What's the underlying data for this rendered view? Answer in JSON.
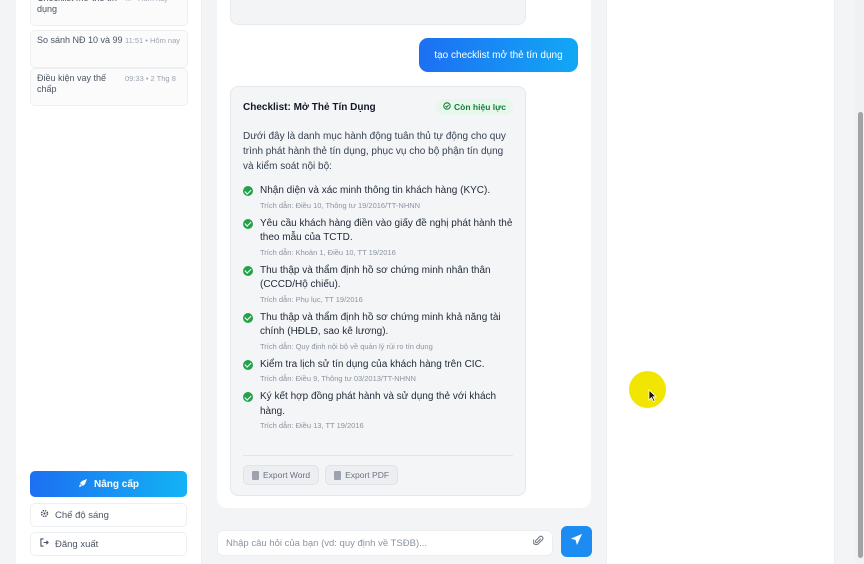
{
  "sidebar": {
    "history": [
      {
        "title": "Checklist mở thẻ tín dụng",
        "time": "... • Hôm nay"
      },
      {
        "title": "So sánh NĐ 10 và 99",
        "time": "11:51 • Hôm nay"
      },
      {
        "title": "Điều kiện vay thế chấp",
        "time": "09:33 • 2 Thg 8"
      }
    ],
    "upgrade_label": "Nâng cấp",
    "light_mode_label": "Chế độ sáng",
    "logout_label": "Đăng xuất"
  },
  "chat": {
    "user_message": "tạo checklist mở thẻ tín dụng",
    "card": {
      "title": "Checklist: Mở Thẻ Tín Dụng",
      "badge": "Còn hiệu lực",
      "intro": "Dưới đây là danh mục hành động tuân thủ tự động cho quy trình phát hành thẻ tín dụng, phục vụ cho bộ phận tín dụng và kiểm soát nội bộ:",
      "items": [
        {
          "text": "Nhận diện và xác minh thông tin khách hàng (KYC).",
          "cite": "Trích dẫn: Điều 10, Thông tư 19/2016/TT-NHNN"
        },
        {
          "text": "Yêu cầu khách hàng điền vào giấy đề nghị phát hành thẻ theo mẫu của TCTD.",
          "cite": "Trích dẫn: Khoản 1, Điều 10, TT 19/2016"
        },
        {
          "text": "Thu thập và thẩm định hồ sơ chứng minh nhân thân (CCCD/Hộ chiếu).",
          "cite": "Trích dẫn: Phụ lục, TT 19/2016"
        },
        {
          "text": "Thu thập và thẩm định hồ sơ chứng minh khả năng tài chính (HĐLĐ, sao kê lương).",
          "cite": "Trích dẫn: Quy định nội bộ về quản lý rủi ro tín dụng"
        },
        {
          "text": "Kiểm tra lịch sử tín dụng của khách hàng trên CIC.",
          "cite": "Trích dẫn: Điều 9, Thông tư 03/2013/TT-NHNN"
        },
        {
          "text": "Ký kết hợp đồng phát hành và sử dụng thẻ với khách hàng.",
          "cite": "Trích dẫn: Điều 13, TT 19/2016"
        }
      ],
      "export_word": "Export Word",
      "export_pdf": "Export PDF"
    },
    "input_placeholder": "Nhập câu hỏi của bạn (vd: quy định về TSĐB)..."
  },
  "colors": {
    "accent": "#1d6ff2",
    "accent_light": "#12b3f5",
    "success": "#22a34a",
    "cursor_highlight": "#f2e600"
  },
  "icons": [
    "rocket-icon",
    "gear-icon",
    "logout-icon",
    "check-circle-icon",
    "document-icon",
    "paperclip-icon",
    "send-icon",
    "cursor-icon"
  ]
}
